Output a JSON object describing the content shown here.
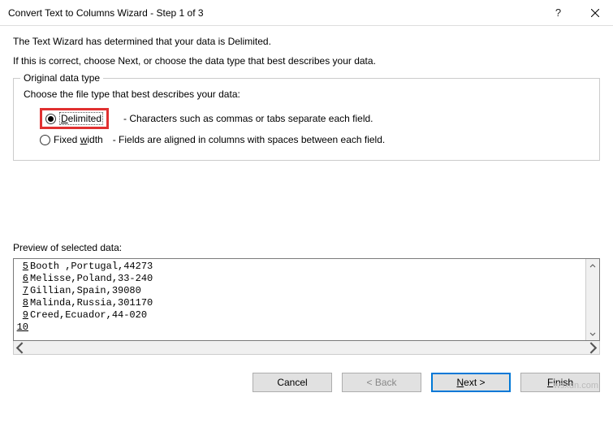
{
  "title": "Convert Text to Columns Wizard - Step 1 of 3",
  "intro1": "The Text Wizard has determined that your data is Delimited.",
  "intro2": "If this is correct, choose Next, or choose the data type that best describes your data.",
  "group": {
    "label": "Original data type",
    "sub": "Choose the file type that best describes your data:",
    "delimited": {
      "accel": "D",
      "rest": "elimited",
      "desc": "- Characters such as commas or tabs separate each field."
    },
    "fixed": {
      "pre": "Fixed ",
      "accel": "w",
      "post": "idth",
      "desc": "- Fields are aligned in columns with spaces between each field."
    }
  },
  "preview": {
    "label": "Preview of selected data:",
    "lines": [
      {
        "n": "5",
        "t": "Booth ,Portugal,44273"
      },
      {
        "n": "6",
        "t": "Melisse,Poland,33-240"
      },
      {
        "n": "7",
        "t": "Gillian,Spain,39080"
      },
      {
        "n": "8",
        "t": "Malinda,Russia,301170"
      },
      {
        "n": "9",
        "t": "Creed,Ecuador,44-020"
      },
      {
        "n": "10",
        "t": ""
      }
    ]
  },
  "buttons": {
    "cancel": "Cancel",
    "back": "< Back",
    "next_accel": "N",
    "next_rest": "ext >",
    "finish_accel": "F",
    "finish_rest": "inish"
  },
  "watermark": "wsxdn.com"
}
